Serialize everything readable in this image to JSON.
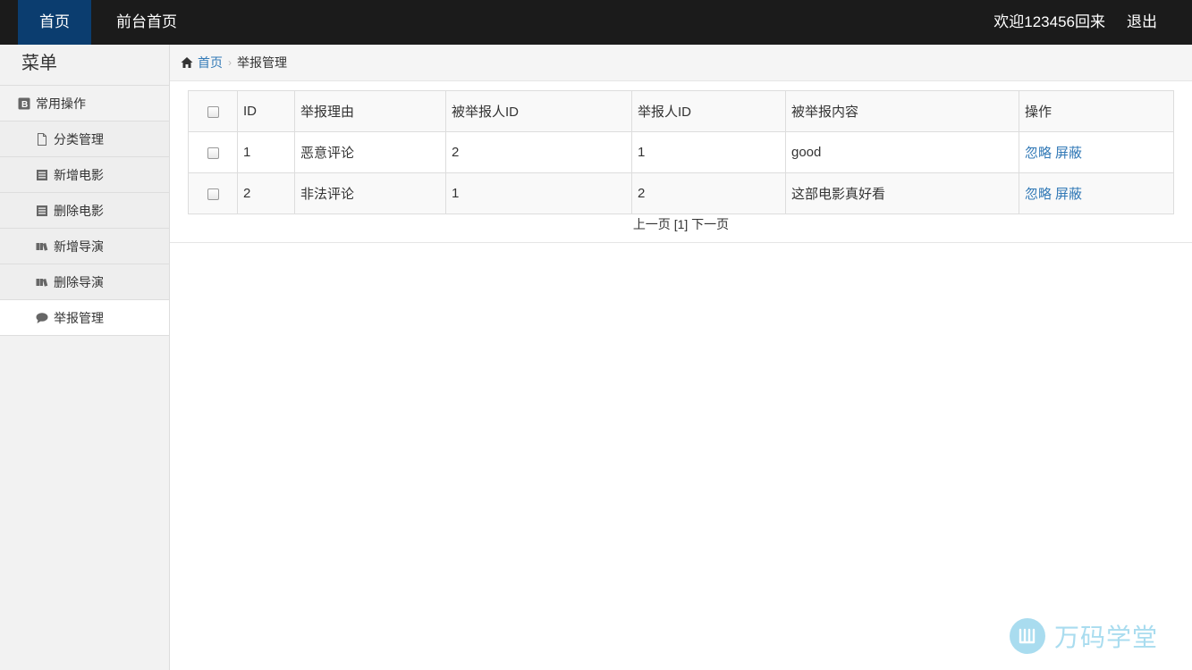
{
  "topbar": {
    "home": "首页",
    "front_home": "前台首页",
    "welcome": "欢迎123456回来",
    "logout": "退出"
  },
  "sidebar": {
    "title": "菜单",
    "group_label": "常用操作",
    "items": [
      {
        "label": "分类管理",
        "icon": "file-icon"
      },
      {
        "label": "新增电影",
        "icon": "list-icon"
      },
      {
        "label": "删除电影",
        "icon": "list-icon"
      },
      {
        "label": "新增导演",
        "icon": "books-icon"
      },
      {
        "label": "删除导演",
        "icon": "books-icon"
      },
      {
        "label": "举报管理",
        "icon": "comment-icon",
        "active": true
      }
    ]
  },
  "breadcrumb": {
    "home": "首页",
    "current": "举报管理"
  },
  "table": {
    "headers": [
      "ID",
      "举报理由",
      "被举报人ID",
      "举报人ID",
      "被举报内容",
      "操作"
    ],
    "rows": [
      {
        "id": "1",
        "reason": "恶意评论",
        "reported_id": "2",
        "reporter_id": "1",
        "content": "good",
        "ignore": "忽略",
        "block": "屏蔽"
      },
      {
        "id": "2",
        "reason": "非法评论",
        "reported_id": "1",
        "reporter_id": "2",
        "content": "这部电影真好看",
        "ignore": "忽略",
        "block": "屏蔽"
      }
    ]
  },
  "pager": {
    "text": "上一页 [1] 下一页"
  },
  "watermark": {
    "text": "万码学堂"
  },
  "colors": {
    "topbar_bg": "#1b1b1b",
    "active_nav": "#0b3d6f",
    "link": "#337ab7",
    "watermark": "#a9dcef"
  }
}
